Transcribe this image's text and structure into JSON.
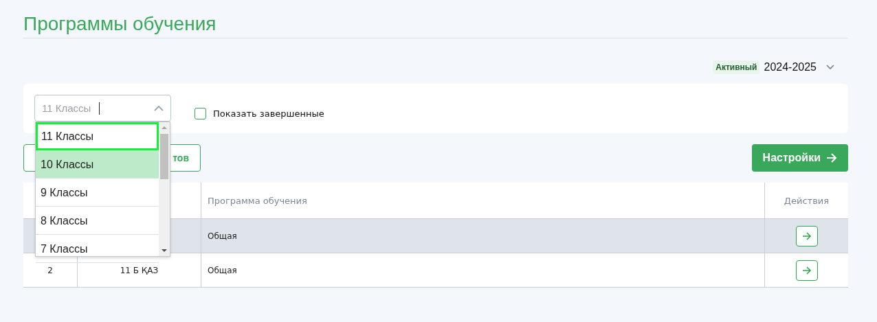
{
  "page": {
    "title": "Программы обучения"
  },
  "year_selector": {
    "badge": "Активный",
    "value": "2024-2025"
  },
  "filters": {
    "class_select": {
      "placeholder": "11 Классы",
      "expanded": true,
      "options": [
        {
          "label": "11 Классы",
          "focused": true,
          "selected": false
        },
        {
          "label": "10 Классы",
          "focused": false,
          "selected": true
        },
        {
          "label": "9 Классы",
          "focused": false,
          "selected": false
        },
        {
          "label": "8 Классы",
          "focused": false,
          "selected": false
        },
        {
          "label": "7 Классы",
          "focused": false,
          "selected": false
        }
      ]
    },
    "show_completed": {
      "label": "Показать завершенные",
      "checked": false
    }
  },
  "toolbar": {
    "partial_button": "тов",
    "settings_button": "Настройки"
  },
  "table": {
    "columns": [
      {
        "label": "Программа обучения"
      },
      {
        "label": "Действия"
      }
    ],
    "rows": [
      {
        "number": "",
        "class": "",
        "program": "Общая",
        "highlighted": true
      },
      {
        "number": "2",
        "class": "11 Б ҚАЗ",
        "program": "Общая",
        "highlighted": false
      }
    ]
  }
}
